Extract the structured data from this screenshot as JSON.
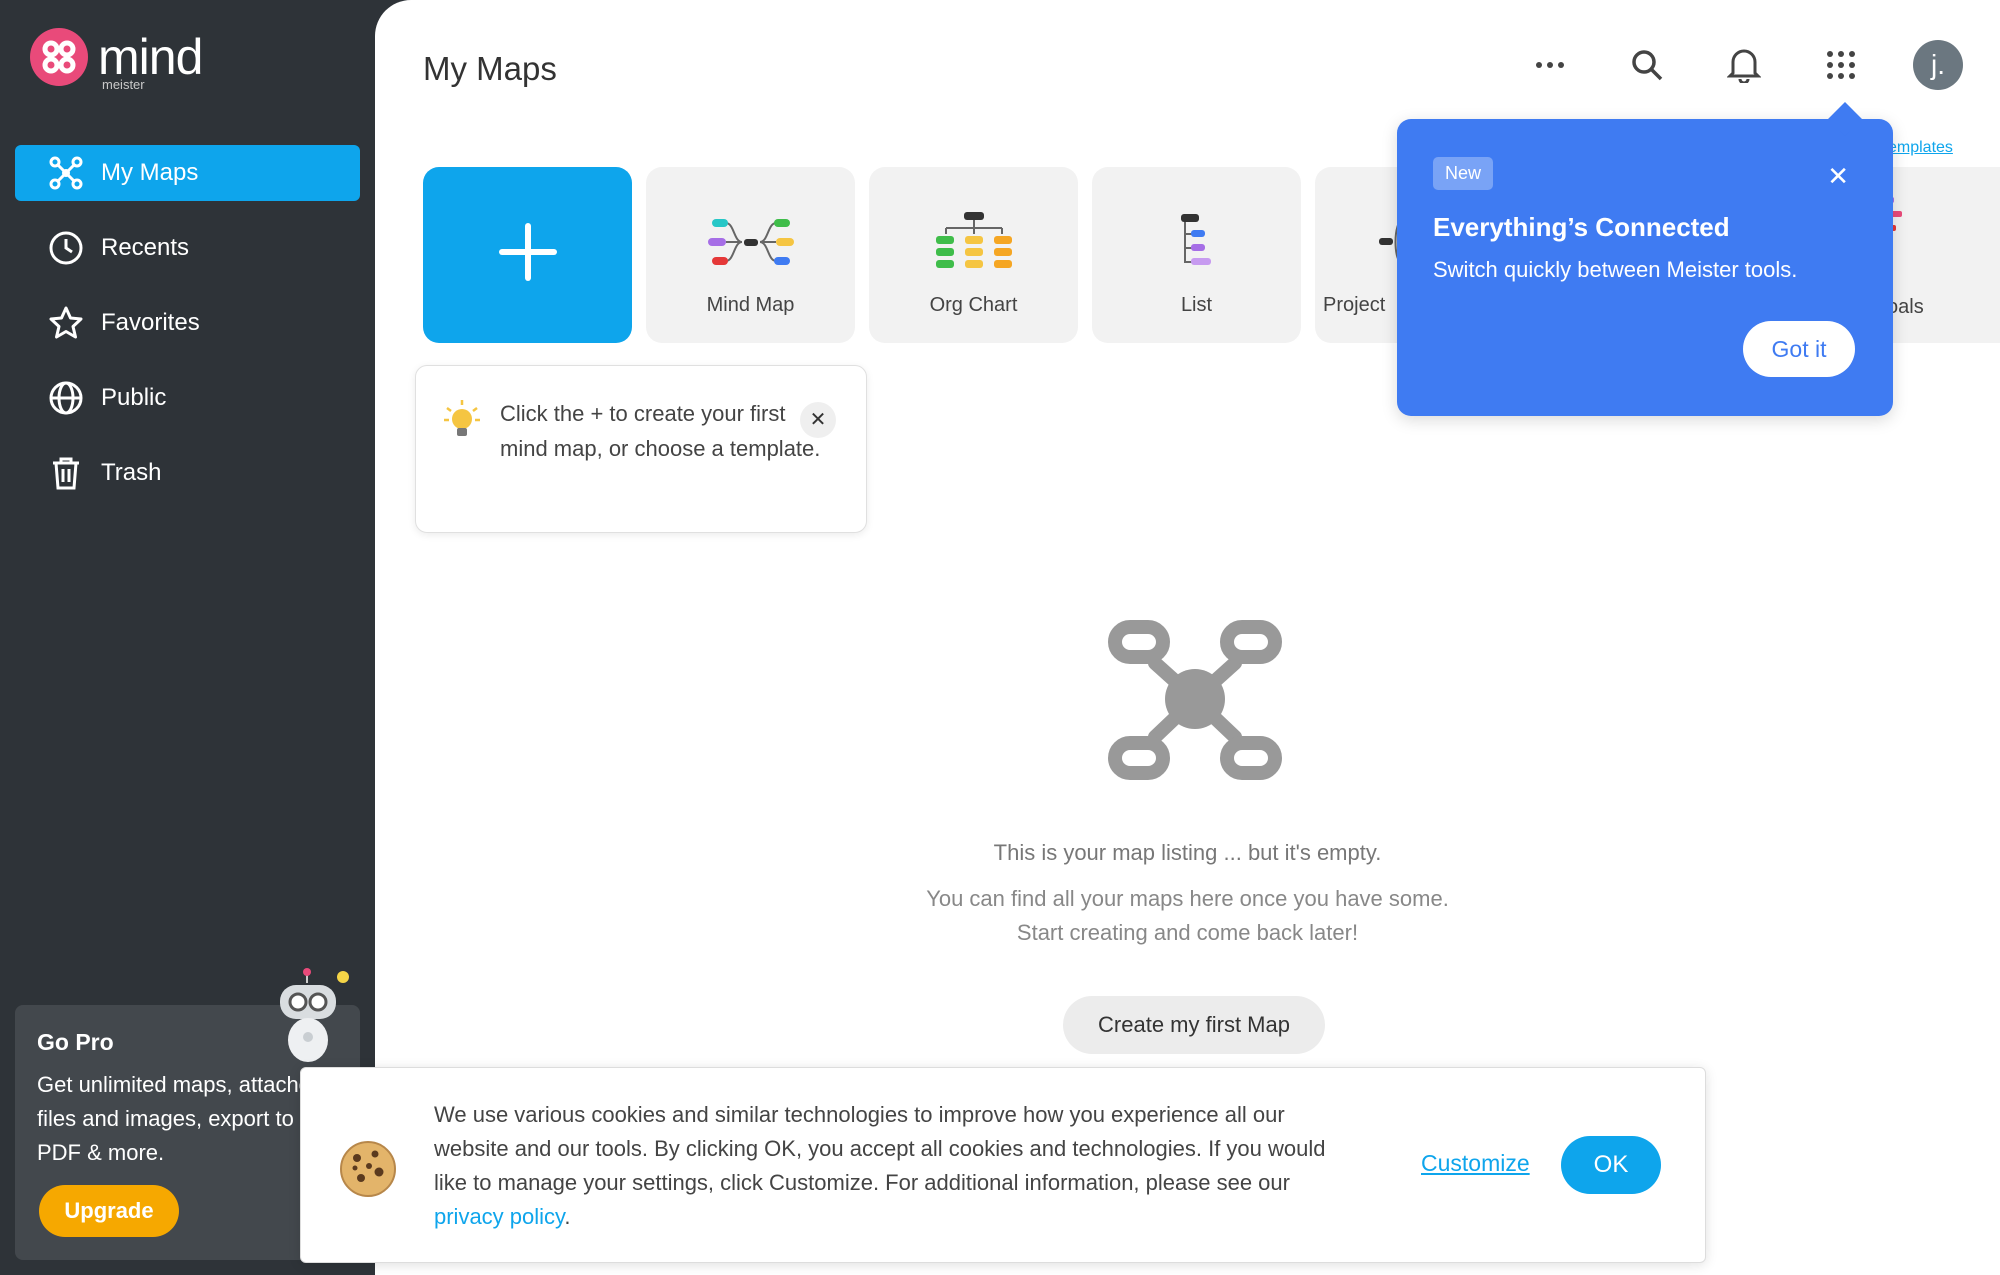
{
  "app": {
    "logo_text": "mind",
    "logo_sub": "meister"
  },
  "sidebar": {
    "items": [
      {
        "label": "My Maps",
        "icon": "mindmap-icon",
        "active": true
      },
      {
        "label": "Recents",
        "icon": "clock-icon",
        "active": false
      },
      {
        "label": "Favorites",
        "icon": "star-icon",
        "active": false
      },
      {
        "label": "Public",
        "icon": "globe-icon",
        "active": false
      },
      {
        "label": "Trash",
        "icon": "trash-icon",
        "active": false
      }
    ],
    "gopro": {
      "title": "Go Pro",
      "text": "Get unlimited maps, attached files and images, export to PDF & more.",
      "button": "Upgrade"
    }
  },
  "header": {
    "title": "My Maps",
    "icons": [
      "more-icon",
      "search-icon",
      "bell-icon",
      "apps-grid-icon"
    ],
    "avatar_initial": "j."
  },
  "templates": {
    "link_label": "Templates",
    "cards": [
      {
        "label": "Mind Map",
        "icon": "mindmap-template-icon"
      },
      {
        "label": "Org Chart",
        "icon": "orgchart-template-icon"
      },
      {
        "label": "List",
        "icon": "list-template-icon"
      },
      {
        "label": "Project",
        "icon": "project-template-icon"
      }
    ],
    "partial_card_label": "oals"
  },
  "hint": {
    "text": "Click the + to create your first mind map, or choose a template."
  },
  "popover": {
    "badge": "New",
    "title": "Everything’s Connected",
    "description": "Switch quickly between Meister tools.",
    "button": "Got it"
  },
  "empty_state": {
    "line1": "This is your map listing ... but it's empty.",
    "line2": "You can find all your maps here once you have some.",
    "line3": "Start creating and come back later!",
    "button": "Create my first Map"
  },
  "cookie": {
    "text": "We use various cookies and similar technologies to improve how you experience all our website and our tools. By clicking OK, you accept all cookies and technologies. If you would like to manage your settings, click Customize. For additional information, please see our ",
    "link": "privacy policy",
    "after_link": ".",
    "customize": "Customize",
    "ok": "OK"
  },
  "colors": {
    "sidebar_bg": "#2e3338",
    "accent": "#0ea5ec",
    "popover": "#3f7bf2",
    "upgrade": "#f6a800",
    "logo": "#e94a7a"
  }
}
